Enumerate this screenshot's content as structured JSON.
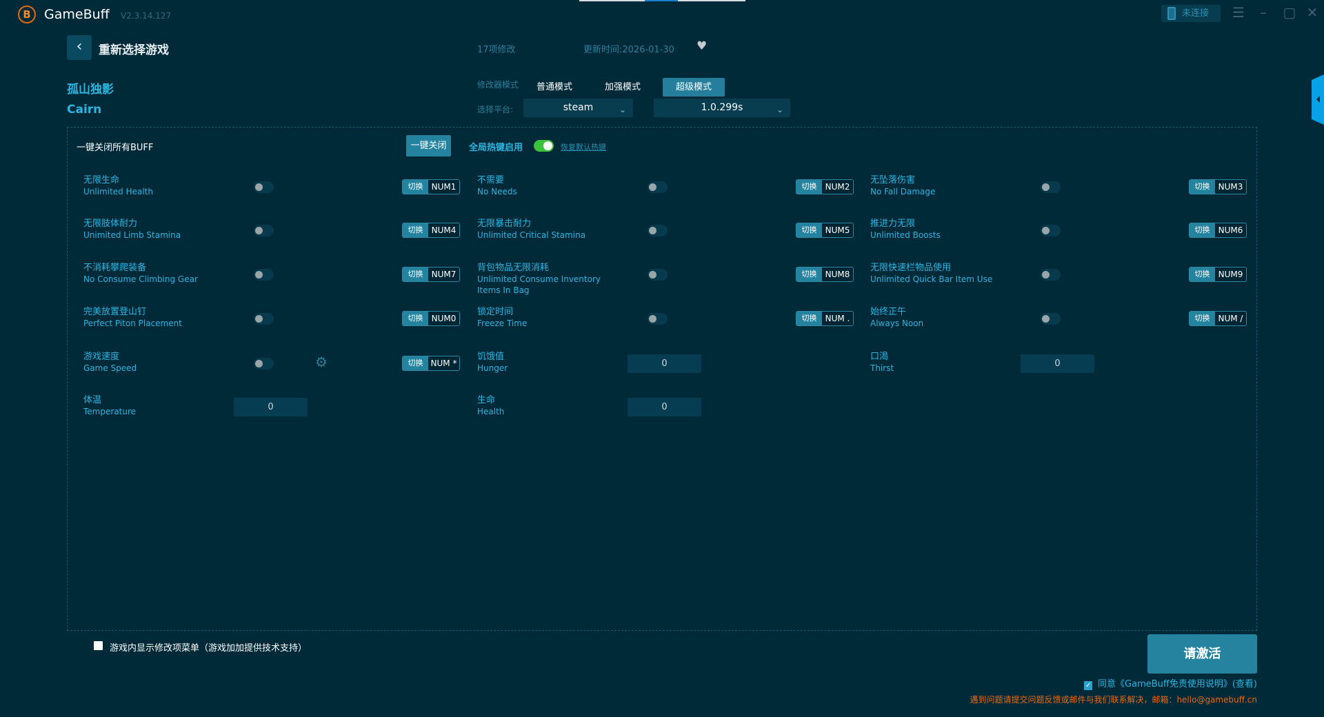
{
  "app": {
    "title": "GameBuff",
    "version": "V2.3.14.127",
    "connect_label": "未连接"
  },
  "header": {
    "back_label": "重新选择游戏",
    "mod_count": "17项修改",
    "update_time": "更新时间:2026-01-30"
  },
  "game": {
    "name_cn": "孤山独影",
    "name_en": "Cairn"
  },
  "mode": {
    "label": "修改器模式",
    "options": [
      "普通模式",
      "加强模式",
      "超级模式"
    ],
    "active": "超级模式"
  },
  "platform": {
    "label": "选择平台:",
    "value": "steam",
    "version": "1.0.299s"
  },
  "controls": {
    "close_all_label": "一键关闭所有BUFF",
    "close_all_button": "一键关闭",
    "hotkey_label": "全局热键启用",
    "hotkey_enabled": true,
    "restore_label": "恢复默认热键"
  },
  "switch_label": "切换",
  "items": [
    {
      "zh": "无限生命",
      "en": "Unlimited Health",
      "type": "toggle",
      "key": "NUM1"
    },
    {
      "zh": "不需要",
      "en": "No Needs",
      "type": "toggle",
      "key": "NUM2"
    },
    {
      "zh": "无坠落伤害",
      "en": "No Fall Damage",
      "type": "toggle",
      "key": "NUM3"
    },
    {
      "zh": "无限肢体耐力",
      "en": "Unimited Limb Stamina",
      "type": "toggle",
      "key": "NUM4"
    },
    {
      "zh": "无限暴击耐力",
      "en": "Unlimited Critical Stamina",
      "type": "toggle",
      "key": "NUM5"
    },
    {
      "zh": "推进力无限",
      "en": "Unlimited Boosts",
      "type": "toggle",
      "key": "NUM6"
    },
    {
      "zh": "不消耗攀爬装备",
      "en": "No Consume Climbing Gear",
      "type": "toggle",
      "key": "NUM7"
    },
    {
      "zh": "背包物品无限消耗",
      "en": "Unlimited Consume Inventory Items In Bag",
      "type": "toggle",
      "key": "NUM8"
    },
    {
      "zh": "无限快速栏物品使用",
      "en": "Unlimited Quick Bar Item Use",
      "type": "toggle",
      "key": "NUM9"
    },
    {
      "zh": "完美放置登山钉",
      "en": "Perfect Piton Placement",
      "type": "toggle",
      "key": "NUM0"
    },
    {
      "zh": "锁定时间",
      "en": "Freeze Time",
      "type": "toggle",
      "key": "NUM ."
    },
    {
      "zh": "始终正午",
      "en": "Always Noon",
      "type": "toggle",
      "key": "NUM /"
    },
    {
      "zh": "游戏速度",
      "en": "Game Speed",
      "type": "toggle_gear",
      "key": "NUM *"
    },
    {
      "zh": "饥饿值",
      "en": "Hunger",
      "type": "input",
      "value": "0"
    },
    {
      "zh": "口渴",
      "en": "Thirst",
      "type": "input",
      "value": "0"
    },
    {
      "zh": "体温",
      "en": "Temperature",
      "type": "input",
      "value": "0"
    },
    {
      "zh": "生命",
      "en": "Health",
      "type": "input",
      "value": "0"
    }
  ],
  "footer": {
    "ingame_menu_label": "游戏内显示修改项菜单（游戏加加提供技术支持）",
    "activate_label": "请激活",
    "agree_label": "同意《GameBuff免责使用说明》(查看)",
    "contact": "遇到问题请提交问题反馈或邮件与我们联系解决，邮箱：hello@gamebuff.cn"
  },
  "colors": {
    "background": "#012a39",
    "accent": "#24839e",
    "label": "#2cb5e0",
    "toggle_on": "#3cc13b",
    "warning": "#ec6a12"
  }
}
